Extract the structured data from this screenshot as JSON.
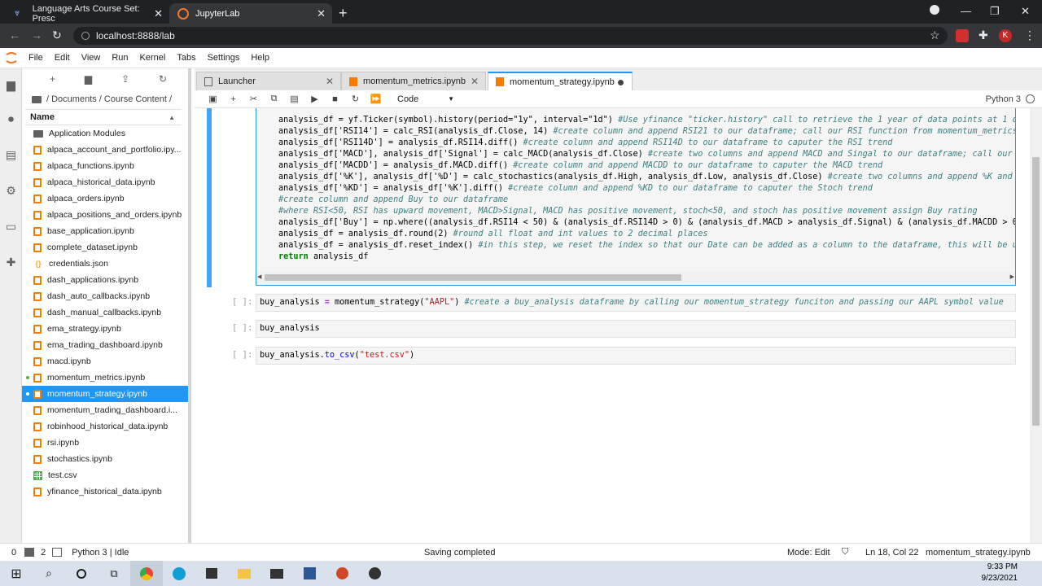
{
  "browser": {
    "tabs": [
      {
        "title": "Language Arts Course Set: Presc",
        "active": false
      },
      {
        "title": "JupyterLab",
        "active": true
      }
    ],
    "url": "localhost:8888/lab",
    "profile_initial": "K"
  },
  "menu": [
    "File",
    "Edit",
    "View",
    "Run",
    "Kernel",
    "Tabs",
    "Settings",
    "Help"
  ],
  "filebrowser": {
    "breadcrumb": "/ Documents / Course Content /",
    "header_name": "Name",
    "items": [
      {
        "name": "Application Modules",
        "type": "folder"
      },
      {
        "name": "alpaca_account_and_portfolio.ipy...",
        "type": "notebook"
      },
      {
        "name": "alpaca_functions.ipynb",
        "type": "notebook"
      },
      {
        "name": "alpaca_historical_data.ipynb",
        "type": "notebook"
      },
      {
        "name": "alpaca_orders.ipynb",
        "type": "notebook"
      },
      {
        "name": "alpaca_positions_and_orders.ipynb",
        "type": "notebook"
      },
      {
        "name": "base_application.ipynb",
        "type": "notebook"
      },
      {
        "name": "complete_dataset.ipynb",
        "type": "notebook"
      },
      {
        "name": "credentials.json",
        "type": "json"
      },
      {
        "name": "dash_applications.ipynb",
        "type": "notebook"
      },
      {
        "name": "dash_auto_callbacks.ipynb",
        "type": "notebook"
      },
      {
        "name": "dash_manual_callbacks.ipynb",
        "type": "notebook"
      },
      {
        "name": "ema_strategy.ipynb",
        "type": "notebook"
      },
      {
        "name": "ema_trading_dashboard.ipynb",
        "type": "notebook"
      },
      {
        "name": "macd.ipynb",
        "type": "notebook"
      },
      {
        "name": "momentum_metrics.ipynb",
        "type": "notebook",
        "running": true
      },
      {
        "name": "momentum_strategy.ipynb",
        "type": "notebook",
        "running": true,
        "selected": true
      },
      {
        "name": "momentum_trading_dashboard.i...",
        "type": "notebook"
      },
      {
        "name": "robinhood_historical_data.ipynb",
        "type": "notebook"
      },
      {
        "name": "rsi.ipynb",
        "type": "notebook"
      },
      {
        "name": "stochastics.ipynb",
        "type": "notebook"
      },
      {
        "name": "test.csv",
        "type": "csv"
      },
      {
        "name": "yfinance_historical_data.ipynb",
        "type": "notebook"
      }
    ]
  },
  "doctabs": [
    {
      "title": "Launcher",
      "icon": "launcher-icon"
    },
    {
      "title": "momentum_metrics.ipynb",
      "icon": "notebook-icon"
    },
    {
      "title": "momentum_strategy.ipynb",
      "icon": "notebook-icon",
      "active": true,
      "dirty": true
    }
  ],
  "nbtoolbar": {
    "cell_type": "Code",
    "kernel": "Python 3"
  },
  "code_lines": [
    "analysis_df = yf.Ticker(symbol).history(period=\"1y\", interval=\"1d\") #Use yfinance \"ticker.history\" call to retrieve the 1 year of data points at 1 day i",
    "analysis_df['RSI14'] = calc_RSI(analysis_df.Close, 14) #create column and append RSI21 to our dataframe; call our RSI function from momentum_metrics, pa",
    "analysis_df['RSI14D'] = analysis_df.RSI14.diff() #create column and append RSI14D to our dataframe to caputer the RSI trend",
    "analysis_df['MACD'], analysis_df['Signal'] = calc_MACD(analysis_df.Close) #create two columns and append MACD and Singal to our dataframe; call our MACD",
    "analysis_df['MACDD'] = analysis_df.MACD.diff() #create column and append MACDD to our dataframe to caputer the MACD trend",
    "analysis_df['%K'], analysis_df['%D'] = calc_stochastics(analysis_df.High, analysis_df.Low, analysis_df.Close) #create two columns and append %K and %D t",
    "analysis_df['%KD'] = analysis_df['%K'].diff() #create column and append %KD to our dataframe to caputer the Stoch trend",
    "#create column and append Buy to our dataframe",
    "#where RSI<50, RSI has upward movement, MACD>Signal, MACD has positive movement, stoch<50, and stoch has positive movement assign Buy rating",
    "analysis_df['Buy'] = np.where((analysis_df.RSI14 < 50) & (analysis_df.RSI14D > 0) & (analysis_df.MACD > analysis_df.Signal) & (analysis_df.MACDD > 0) &",
    "analysis_df = analysis_df.round(2) #round all float and int values to 2 decimal places",
    "analysis_df = analysis_df.reset_index() #in this step, we reset the index so that our Date can be added as a column to the dataframe, this will be usefu",
    "return analysis_df"
  ],
  "cells": [
    {
      "prompt": "[ ]:",
      "code": "buy_analysis = momentum_strategy(\"AAPL\") #create a buy_analysis dataframe by calling our momentum_strategy funciton and passing our AAPL symbol value"
    },
    {
      "prompt": "[ ]:",
      "code": "buy_analysis"
    },
    {
      "prompt": "[ ]:",
      "code": "buy_analysis.to_csv(\"test.csv\")"
    }
  ],
  "status": {
    "left_num1": "0",
    "left_num2": "2",
    "kernel": "Python 3 | Idle",
    "message": "Saving completed",
    "mode": "Mode: Edit",
    "position": "Ln 18, Col 22",
    "filename": "momentum_strategy.ipynb"
  },
  "taskbar": {
    "time": "9:33 PM",
    "date": "9/23/2021"
  },
  "colors": {
    "accent": "#2196f3",
    "notebook_icon": "#f57c00",
    "chrome_dark": "#202124"
  }
}
